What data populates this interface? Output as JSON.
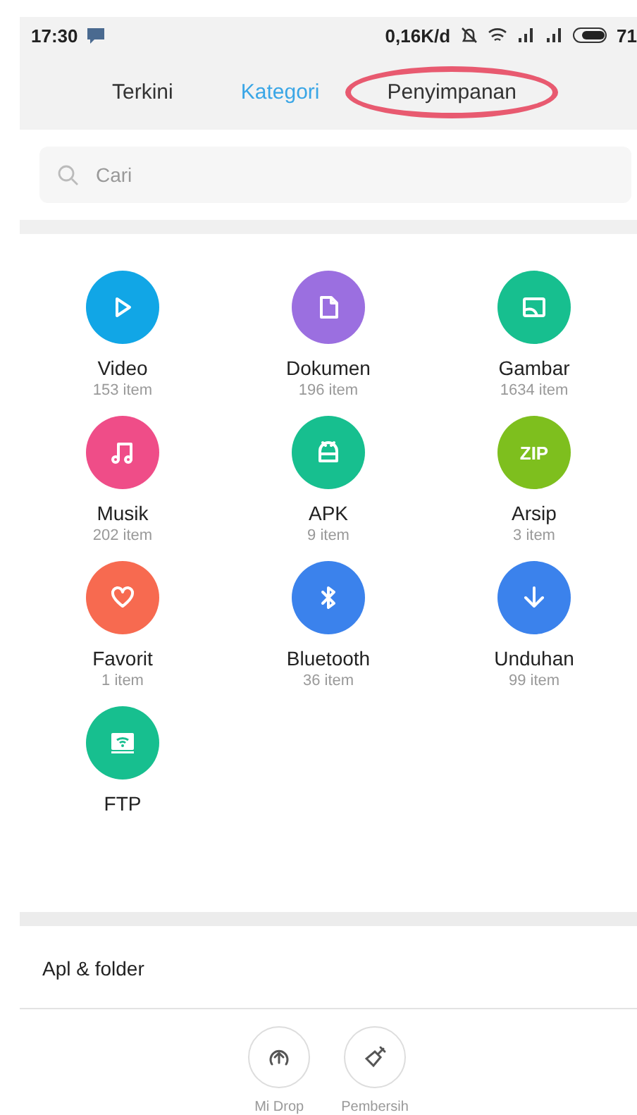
{
  "status_bar": {
    "time": "17:30",
    "network_speed": "0,16K/d",
    "battery": "71"
  },
  "tabs": [
    {
      "label": "Terkini",
      "selected": false,
      "circled": false
    },
    {
      "label": "Kategori",
      "selected": true,
      "circled": false
    },
    {
      "label": "Penyimpanan",
      "selected": false,
      "circled": true
    }
  ],
  "search": {
    "placeholder": "Cari"
  },
  "categories": [
    {
      "name": "Video",
      "count": "153 item",
      "kind": "video",
      "color": "#11a6e6"
    },
    {
      "name": "Dokumen",
      "count": "196 item",
      "kind": "document",
      "color": "#9b6fe0"
    },
    {
      "name": "Gambar",
      "count": "1634 item",
      "kind": "image",
      "color": "#17bf8f"
    },
    {
      "name": "Musik",
      "count": "202 item",
      "kind": "music",
      "color": "#ef4d88"
    },
    {
      "name": "APK",
      "count": "9 item",
      "kind": "apk",
      "color": "#17bf8f"
    },
    {
      "name": "Arsip",
      "count": "3 item",
      "kind": "zip",
      "color": "#7ebf1e",
      "icon_text": "ZIP"
    },
    {
      "name": "Favorit",
      "count": "1 item",
      "kind": "heart",
      "color": "#f76a50"
    },
    {
      "name": "Bluetooth",
      "count": "36 item",
      "kind": "bluetooth",
      "color": "#3b82ec"
    },
    {
      "name": "Unduhan",
      "count": "99 item",
      "kind": "download",
      "color": "#3b82ec"
    },
    {
      "name": "FTP",
      "kind": "ftp",
      "color": "#17bf8f"
    }
  ],
  "section": {
    "title": "Apl & folder"
  },
  "bottom_actions": [
    {
      "label": "Mi Drop",
      "kind": "upload"
    },
    {
      "label": "Pembersih",
      "kind": "brush"
    }
  ]
}
